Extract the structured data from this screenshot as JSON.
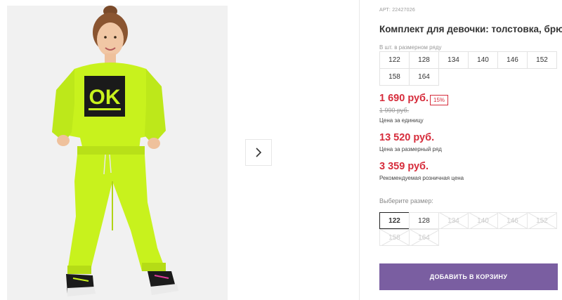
{
  "product": {
    "sku": "АРТ: 22427026",
    "title": "Комплект для девочки: толстовка, брюки",
    "sweatshirt_print": "OK"
  },
  "size_row": {
    "label": "В шт. в размерном ряду",
    "sizes": [
      "122",
      "128",
      "134",
      "140",
      "146",
      "152",
      "158",
      "164"
    ]
  },
  "pricing": {
    "price": "1 690 руб.",
    "discount": "15%",
    "old_price": "1 990 руб.",
    "unit_label": "Цена за единицу",
    "row_price": "13 520 руб.",
    "row_label": "Цена за размерный ряд",
    "retail_price": "3 359 руб.",
    "retail_label": "Рекомендуемая розничная цена"
  },
  "size_picker": {
    "label": "Выберите размер:",
    "options": [
      {
        "size": "122",
        "state": "selected"
      },
      {
        "size": "128",
        "state": "available"
      },
      {
        "size": "134",
        "state": "unavailable"
      },
      {
        "size": "140",
        "state": "unavailable"
      },
      {
        "size": "146",
        "state": "unavailable"
      },
      {
        "size": "152",
        "state": "unavailable"
      },
      {
        "size": "158",
        "state": "unavailable"
      },
      {
        "size": "164",
        "state": "unavailable"
      }
    ]
  },
  "cart": {
    "button_label": "ДОБАВИТЬ В КОРЗИНУ"
  },
  "gallery": {
    "next_icon": "chevron-right-icon"
  },
  "colors": {
    "accent": "#7a5ea1",
    "price_red": "#d62c3b",
    "neon_green": "#c8f21d"
  }
}
